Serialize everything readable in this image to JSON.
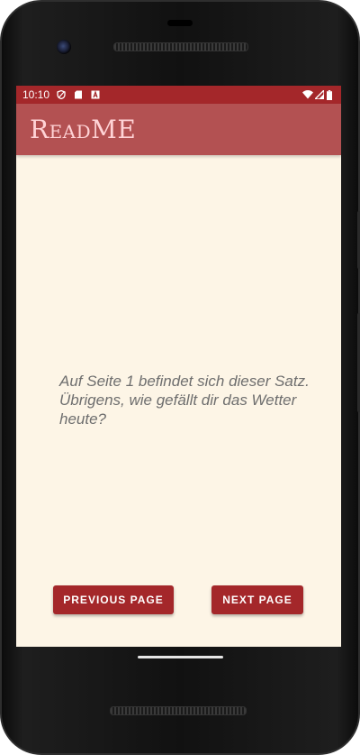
{
  "status_bar": {
    "time": "10:10",
    "left_icons": [
      "shield-icon",
      "sd-card-icon",
      "font-a-icon"
    ],
    "right_icons": [
      "wifi-icon",
      "cell-signal-icon",
      "battery-icon"
    ]
  },
  "app_bar": {
    "title": "ReadME"
  },
  "content": {
    "page_text": "Auf Seite 1 befindet sich dieser Satz. Übrigens, wie gefällt dir das Wetter heute?"
  },
  "buttons": {
    "previous_label": "PREVIOUS PAGE",
    "next_label": "NEXT PAGE"
  },
  "colors": {
    "status_bar": "#a4272a",
    "app_bar": "#b35152",
    "title_text": "#ffd3d6",
    "background": "#fdf5e6",
    "button": "#a4272a"
  }
}
